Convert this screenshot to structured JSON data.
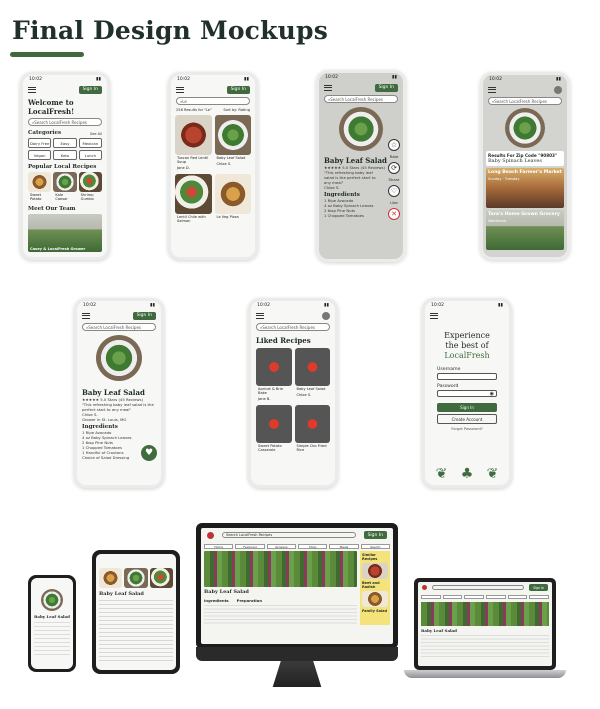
{
  "page": {
    "title": "Final Design Mockups",
    "accent": "#3e6a3e"
  },
  "common": {
    "time": "10:02",
    "sign_in": "Sign In",
    "search_placeholder": "Search LocalFresh Recipes"
  },
  "home": {
    "welcome": "Welcome to LocalFresh!",
    "categories_label": "Categories",
    "see_all": "See All",
    "categories": [
      "Dairy Free",
      "Easy",
      "Mexican",
      "Vegan",
      "Keto",
      "Lunch"
    ],
    "popular_label": "Popular Local Recipes",
    "popular": [
      "Sweet Potato",
      "Kale Caesar",
      "Shrimp Gumbo"
    ],
    "team_label": "Meet Our Team",
    "team_caption": "Casey & LocalFresh Grower"
  },
  "results": {
    "query": "Le",
    "count": "256 Results for \"Le\"",
    "sort": "Sort by: Rating",
    "items": [
      "Tuscan Red Lentil Soup",
      "Baby Leaf Salad",
      "Lentil Chile with Salmon",
      "Le Veg Pizza"
    ],
    "authors": [
      "Jane D.",
      "Chloe S."
    ]
  },
  "detail": {
    "name": "Baby Leaf Salad",
    "rating": "5.0 Stars (45 Reviews)",
    "quote": "\"This refreshing baby leaf salad is the perfect start to any meal\"",
    "author": "Chloe S.",
    "location": "Grower in St. Louis, MO",
    "ingredients_label": "Ingredients",
    "ingredients": [
      "1 Ripe Avocado",
      "4 oz Baby Spinach Leaves",
      "2 tbsp Pine Nuts",
      "1 Chopped Tomatoes",
      "1 Handful of Croutons",
      "Choice of Salad Dressing"
    ],
    "actions": [
      "Rate",
      "Share",
      "Like"
    ]
  },
  "zip": {
    "heading": "Results For Zip Code \"90803\"",
    "sub": "Baby Spinach Leaves",
    "market": "Long Beach Farmer's Market",
    "market_meta": "Sunday · Tuesday",
    "grocery": "Tara's Home Grown Grocery",
    "grocery_meta": "Weekends"
  },
  "liked": {
    "heading": "Liked Recipes",
    "items": [
      "Apricot & Brie Bake",
      "Baby Leaf Salad",
      "Sweet Potato Casserole",
      "Simple Cko Fried Rice"
    ],
    "authors": [
      "Jane B.",
      "Chloe S."
    ]
  },
  "login": {
    "headline_1": "Experience",
    "headline_2": "the best of",
    "brand": "LocalFresh",
    "username_label": "Username",
    "password_label": "Password",
    "sign_in": "Sign In",
    "create": "Create Account",
    "forgot": "Forgot Password?"
  },
  "desktop": {
    "nav": [
      "Home",
      "Featured",
      "Growers",
      "Shop",
      "Meals",
      "Search"
    ],
    "recipe": "Baby Leaf Salad",
    "similar": "Similar Recipes",
    "similar_item": "Beet and Radish",
    "similar_item2": "Family Salad",
    "ingredients": "Ingredients",
    "prep": "Preparation"
  }
}
